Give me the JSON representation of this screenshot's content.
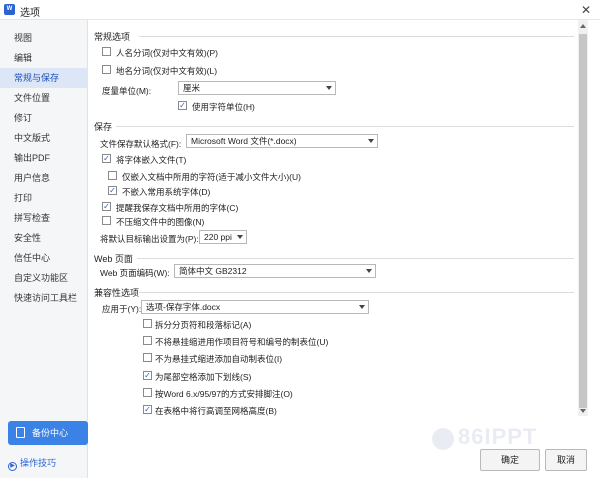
{
  "window": {
    "title": "选项",
    "app_icon_text": "W"
  },
  "sidebar": {
    "items": [
      {
        "label": "视图"
      },
      {
        "label": "编辑"
      },
      {
        "label": "常规与保存"
      },
      {
        "label": "文件位置"
      },
      {
        "label": "修订"
      },
      {
        "label": "中文版式"
      },
      {
        "label": "输出PDF"
      },
      {
        "label": "用户信息"
      },
      {
        "label": "打印"
      },
      {
        "label": "拼写检查"
      },
      {
        "label": "安全性"
      },
      {
        "label": "信任中心"
      },
      {
        "label": "自定义功能区"
      },
      {
        "label": "快速访问工具栏"
      }
    ],
    "active_index": 2,
    "backup_button": "备份中心",
    "tips_link": "操作技巧"
  },
  "general": {
    "title": "常规选项",
    "opt_person_name": {
      "label": "人名分词(仅对中文有效)(P)",
      "checked": false
    },
    "opt_place_name": {
      "label": "地名分词(仅对中文有效)(L)",
      "checked": false
    },
    "unit_label": "度量单位(M):",
    "unit_value": "厘米",
    "opt_char_unit": {
      "label": "使用字符单位(H)",
      "checked": true
    }
  },
  "save": {
    "title": "保存",
    "format_label": "文件保存默认格式(F):",
    "format_value": "Microsoft Word 文件(*.docx)",
    "opt_embed_fonts": {
      "label": "将字体嵌入文件(T)",
      "checked": true
    },
    "opt_embed_used_only": {
      "label": "仅嵌入文档中所用的字符(适于减小文件大小)(U)",
      "checked": false
    },
    "opt_no_system_fonts": {
      "label": "不嵌入常用系统字体(D)",
      "checked": true
    },
    "opt_remind_fonts": {
      "label": "提醒我保存文档中所用的字体(C)",
      "checked": true
    },
    "opt_no_compress": {
      "label": "不压缩文件中的图像(N)",
      "checked": false
    },
    "output_label": "将默认目标输出设置为(P):",
    "output_value": "220 ppi"
  },
  "web": {
    "title": "Web 页面",
    "encoding_label": "Web 页面编码(W):",
    "encoding_value": "简体中文 GB2312"
  },
  "compat": {
    "title": "兼容性选项",
    "apply_label": "应用于(Y):",
    "apply_value": "选项-保存字体.docx",
    "options": [
      {
        "label": "拆分分页符和段落标记(A)",
        "checked": false
      },
      {
        "label": "不将悬挂缩进用作项目符号和编号的制表位(U)",
        "checked": false
      },
      {
        "label": "不为悬挂式缩进添加自动制表位(I)",
        "checked": false
      },
      {
        "label": "为尾部空格添加下划线(S)",
        "checked": true
      },
      {
        "label": "按Word 6.x/95/97的方式安排脚注(O)",
        "checked": false
      },
      {
        "label": "在表格中将行高调至网格高度(B)",
        "checked": true
      }
    ]
  },
  "footer": {
    "ok": "确定",
    "cancel": "取消"
  },
  "watermark": "86IPPT",
  "colors": {
    "accent": "#3b82e6",
    "active_nav_bg": "#dde6f6",
    "check": "#2b5fc8"
  }
}
